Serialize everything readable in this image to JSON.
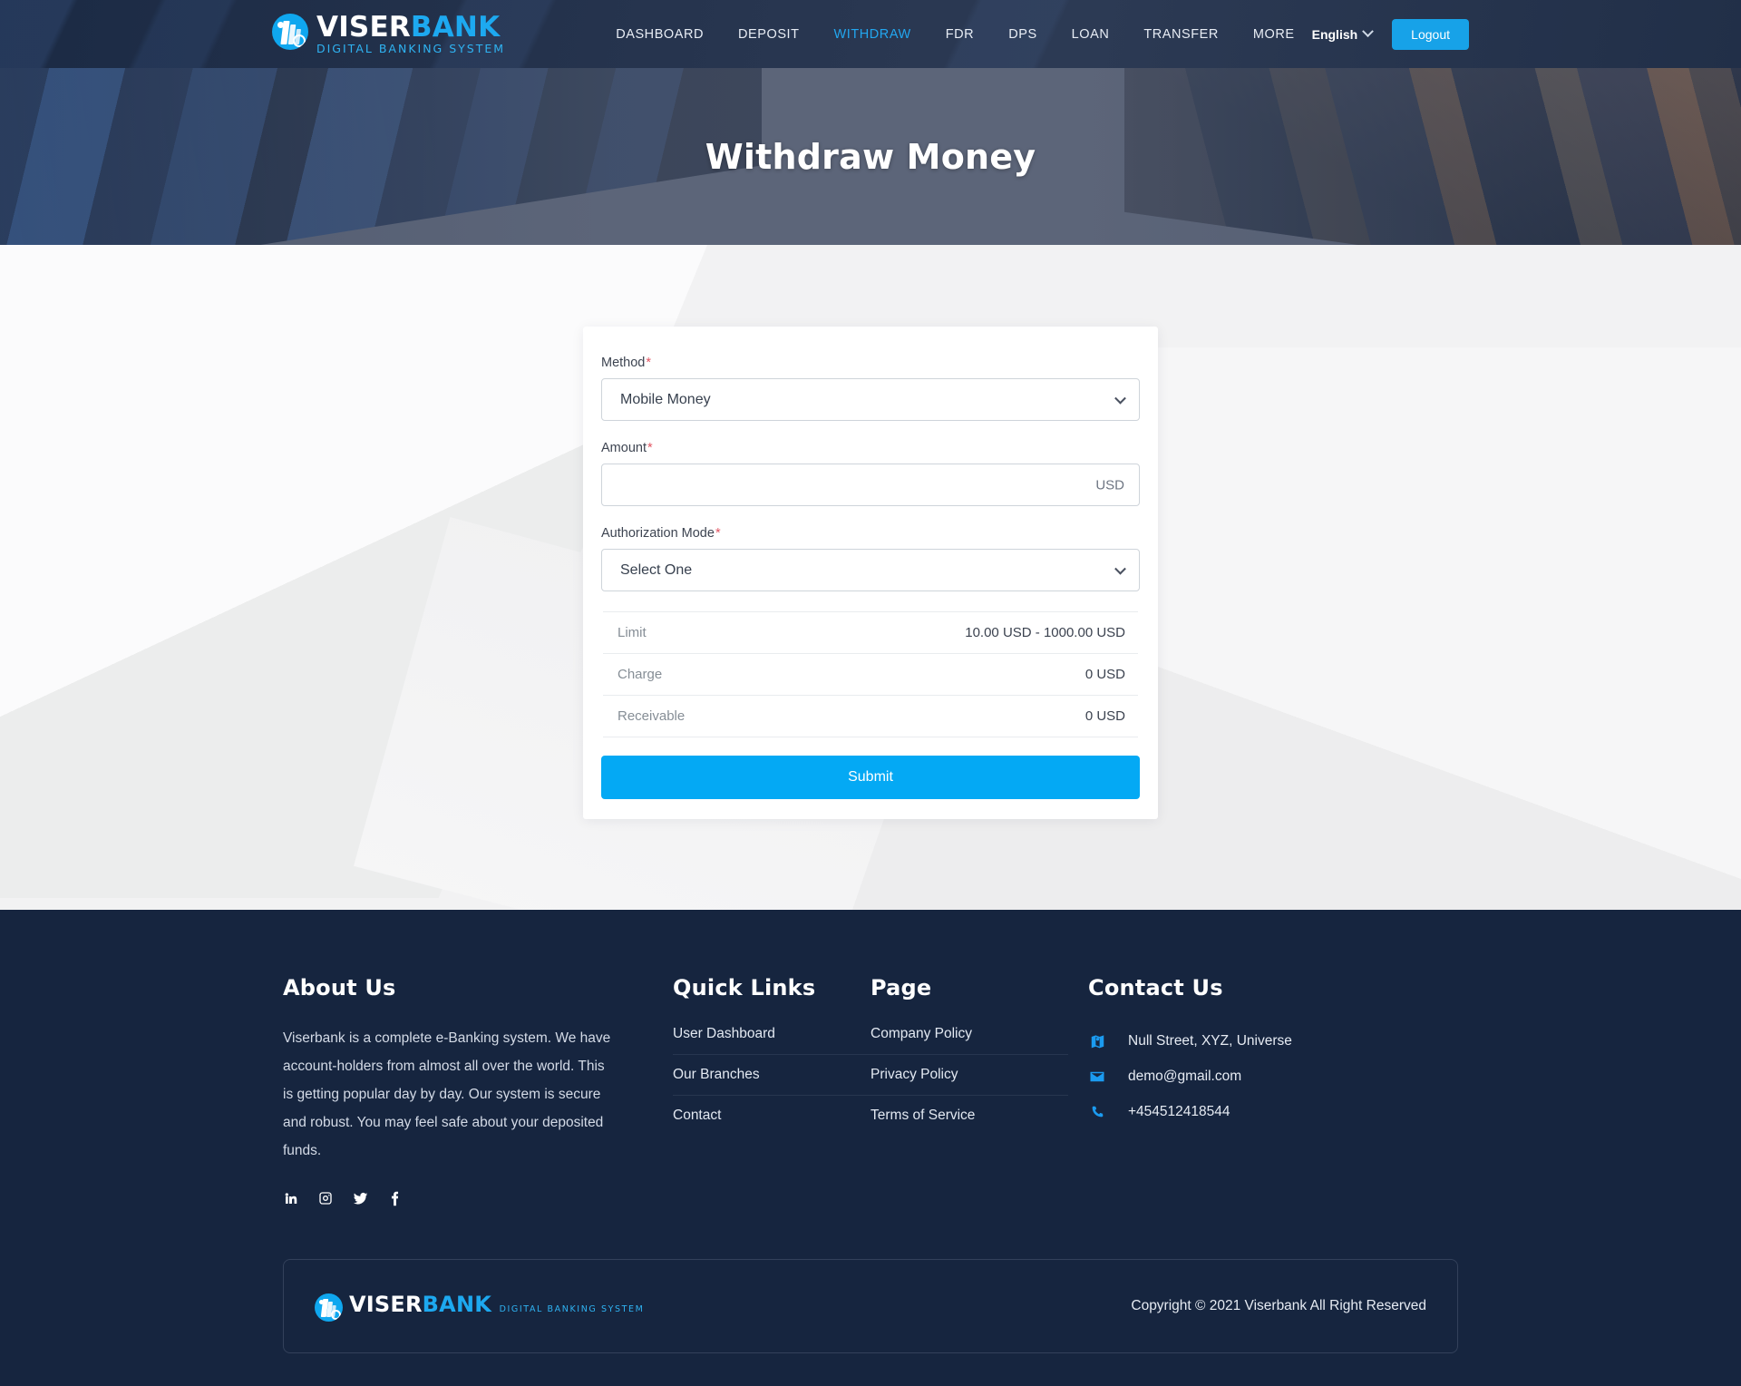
{
  "brand": {
    "name_part1": "VISER",
    "name_part2": "BANK",
    "tagline": "DIGITAL BANKING SYSTEM",
    "accent_color": "#1da9f0",
    "primary_button_color": "#04a9f4",
    "header_bg": "#22304a",
    "footer_bg": "#16253f"
  },
  "header": {
    "nav": [
      {
        "label": "DASHBOARD",
        "active": false
      },
      {
        "label": "DEPOSIT",
        "active": false
      },
      {
        "label": "WITHDRAW",
        "active": true
      },
      {
        "label": "FDR",
        "active": false
      },
      {
        "label": "DPS",
        "active": false
      },
      {
        "label": "LOAN",
        "active": false
      },
      {
        "label": "TRANSFER",
        "active": false
      },
      {
        "label": "MORE",
        "active": false
      }
    ],
    "language": "English",
    "language_icon": "chevron-down-icon",
    "logout_label": "Logout"
  },
  "hero": {
    "title": "Withdraw Money"
  },
  "form": {
    "method": {
      "label": "Method",
      "required_mark": "*",
      "selected": "Mobile Money",
      "options": [
        "Mobile Money"
      ]
    },
    "amount": {
      "label": "Amount",
      "required_mark": "*",
      "value": "",
      "placeholder": "",
      "currency_suffix": "USD"
    },
    "authorization_mode": {
      "label": "Authorization Mode",
      "required_mark": "*",
      "selected": "Select One",
      "options": [
        "Select One"
      ]
    },
    "info_rows": [
      {
        "key": "Limit",
        "value": "10.00 USD - 1000.00 USD"
      },
      {
        "key": "Charge",
        "value": "0 USD"
      },
      {
        "key": "Receivable",
        "value": "0 USD"
      }
    ],
    "submit_label": "Submit"
  },
  "footer": {
    "about": {
      "heading": "About Us",
      "text": "Viserbank is a complete e-Banking system. We have account-holders from almost all over the world. This is getting popular day by day. Our system is secure and robust. You may feel safe about your deposited funds.",
      "socials": [
        {
          "name": "linkedin-icon"
        },
        {
          "name": "instagram-icon"
        },
        {
          "name": "twitter-icon"
        },
        {
          "name": "facebook-icon"
        }
      ]
    },
    "quick_links": {
      "heading": "Quick Links",
      "items": [
        "User Dashboard",
        "Our Branches",
        "Contact"
      ]
    },
    "page": {
      "heading": "Page",
      "items": [
        "Company Policy",
        "Privacy Policy",
        "Terms of Service"
      ]
    },
    "contact": {
      "heading": "Contact Us",
      "items": [
        {
          "icon": "map-location-icon",
          "text": "Null Street, XYZ, Universe"
        },
        {
          "icon": "envelope-icon",
          "text": "demo@gmail.com"
        },
        {
          "icon": "phone-icon",
          "text": "+454512418544"
        }
      ]
    },
    "copyright": "Copyright © 2021 Viserbank All Right Reserved"
  }
}
